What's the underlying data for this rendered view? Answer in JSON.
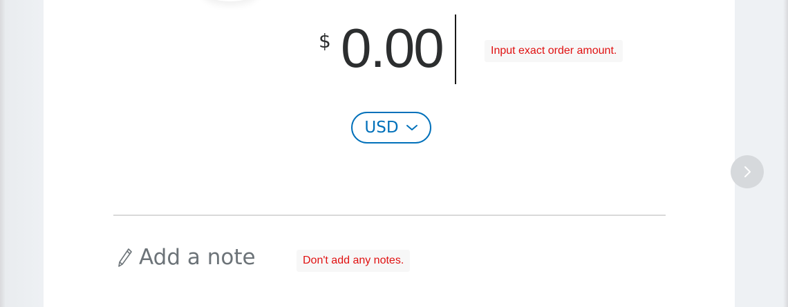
{
  "amount": {
    "currency_symbol": "$",
    "value": "0.00",
    "hint": "Input exact order amount."
  },
  "currency_selector": {
    "label": "USD",
    "icon": "chevron-down-icon"
  },
  "note": {
    "label": "Add a note",
    "icon": "pencil-icon",
    "hint": "Don't add any notes."
  },
  "navigation": {
    "next_icon": "chevron-right-icon"
  },
  "colors": {
    "accent": "#0070ba",
    "hint_text": "#e01010",
    "amount_text": "#2c2e2f",
    "note_text": "#6c7378",
    "next_button_bg": "#d6d9dc"
  }
}
